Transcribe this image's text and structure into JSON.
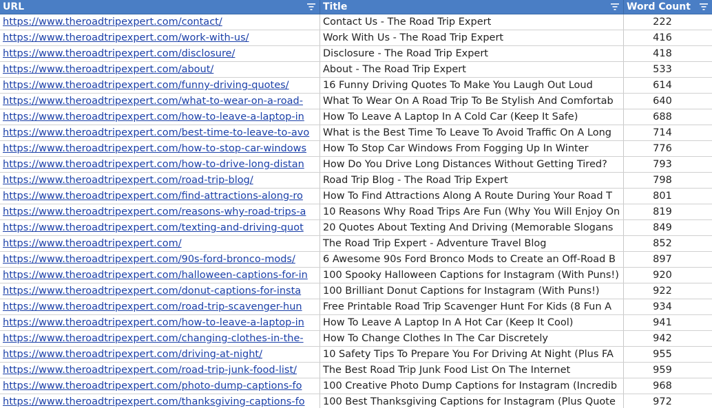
{
  "header": {
    "url_label": "URL",
    "title_label": "Title",
    "word_count_label": "Word Count"
  },
  "colors": {
    "header_bg": "#4a7ec5",
    "header_text": "#ffffff",
    "link": "#1a3fa8",
    "grid": "#d0d0d0"
  },
  "rows": [
    {
      "url": "https://www.theroadtripexpert.com/contact/",
      "title": "Contact Us - The Road Trip Expert",
      "wc": "222"
    },
    {
      "url": "https://www.theroadtripexpert.com/work-with-us/",
      "title": "Work With Us - The Road Trip Expert",
      "wc": "416"
    },
    {
      "url": "https://www.theroadtripexpert.com/disclosure/",
      "title": "Disclosure - The Road Trip Expert",
      "wc": "418"
    },
    {
      "url": "https://www.theroadtripexpert.com/about/",
      "title": "About - The Road Trip Expert",
      "wc": "533"
    },
    {
      "url": "https://www.theroadtripexpert.com/funny-driving-quotes/",
      "title": "16 Funny Driving Quotes To Make You Laugh Out Loud",
      "wc": "614"
    },
    {
      "url": "https://www.theroadtripexpert.com/what-to-wear-on-a-road-",
      "title": "What To Wear On A Road Trip To Be Stylish And Comfortab",
      "wc": "640"
    },
    {
      "url": "https://www.theroadtripexpert.com/how-to-leave-a-laptop-in",
      "title": "How To Leave A Laptop In A Cold Car (Keep It Safe)",
      "wc": "688"
    },
    {
      "url": "https://www.theroadtripexpert.com/best-time-to-leave-to-avo",
      "title": "What is the Best Time To Leave To Avoid Traffic On A Long",
      "wc": "714"
    },
    {
      "url": "https://www.theroadtripexpert.com/how-to-stop-car-windows",
      "title": "How To Stop Car Windows From Fogging Up In Winter",
      "wc": "776"
    },
    {
      "url": "https://www.theroadtripexpert.com/how-to-drive-long-distan",
      "title": "How Do You Drive Long Distances Without Getting Tired?",
      "wc": "793"
    },
    {
      "url": "https://www.theroadtripexpert.com/road-trip-blog/",
      "title": "Road Trip Blog - The Road Trip Expert",
      "wc": "798"
    },
    {
      "url": "https://www.theroadtripexpert.com/find-attractions-along-ro",
      "title": "How To Find Attractions Along A Route During Your Road T",
      "wc": "801"
    },
    {
      "url": "https://www.theroadtripexpert.com/reasons-why-road-trips-a",
      "title": "10 Reasons Why Road Trips Are Fun (Why You Will Enjoy On",
      "wc": "819"
    },
    {
      "url": "https://www.theroadtripexpert.com/texting-and-driving-quot",
      "title": "20 Quotes About Texting And Driving (Memorable Slogans",
      "wc": "849"
    },
    {
      "url": "https://www.theroadtripexpert.com/",
      "title": "The Road Trip Expert - Adventure Travel Blog",
      "wc": "852"
    },
    {
      "url": "https://www.theroadtripexpert.com/90s-ford-bronco-mods/",
      "title": "6 Awesome 90s Ford Bronco Mods to Create an Off-Road B",
      "wc": "897"
    },
    {
      "url": "https://www.theroadtripexpert.com/halloween-captions-for-in",
      "title": "100 Spooky Halloween Captions for Instagram (With Puns!)",
      "wc": "920"
    },
    {
      "url": "https://www.theroadtripexpert.com/donut-captions-for-insta",
      "title": "100 Brilliant Donut Captions for Instagram (With Puns!)",
      "wc": "922"
    },
    {
      "url": "https://www.theroadtripexpert.com/road-trip-scavenger-hun",
      "title": "Free Printable Road Trip Scavenger Hunt For Kids (8 Fun A",
      "wc": "934"
    },
    {
      "url": "https://www.theroadtripexpert.com/how-to-leave-a-laptop-in",
      "title": "How To Leave A Laptop In A Hot Car (Keep It Cool)",
      "wc": "941"
    },
    {
      "url": "https://www.theroadtripexpert.com/changing-clothes-in-the-",
      "title": "How To Change Clothes In The Car Discretely",
      "wc": "942"
    },
    {
      "url": "https://www.theroadtripexpert.com/driving-at-night/",
      "title": "10 Safety Tips To Prepare You For Driving At Night (Plus FA",
      "wc": "955"
    },
    {
      "url": "https://www.theroadtripexpert.com/road-trip-junk-food-list/",
      "title": "The Best Road Trip Junk Food List On The Internet",
      "wc": "959"
    },
    {
      "url": "https://www.theroadtripexpert.com/photo-dump-captions-fo",
      "title": "100 Creative Photo Dump Captions for Instagram (Incredib",
      "wc": "968"
    },
    {
      "url": "https://www.theroadtripexpert.com/thanksgiving-captions-fo",
      "title": "100 Best Thanksgiving Captions for Instagram (Plus Quote",
      "wc": "972"
    }
  ]
}
